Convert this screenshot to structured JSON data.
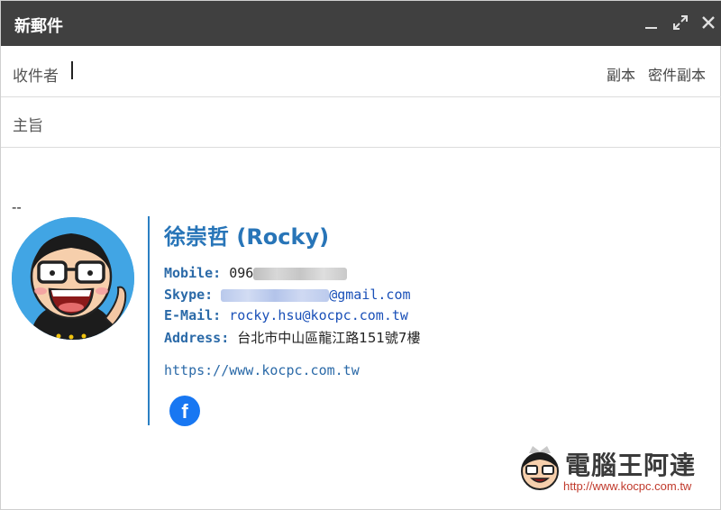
{
  "window": {
    "title": "新郵件"
  },
  "compose": {
    "to_label": "收件者",
    "cc_label": "副本",
    "bcc_label": "密件副本",
    "subject_label": "主旨"
  },
  "body": {
    "separator": "--"
  },
  "signature": {
    "name": "徐崇哲 (Rocky)",
    "mobile_label": "Mobile:",
    "mobile_value": "096",
    "skype_label": "Skype:",
    "skype_value": "@gmail.com",
    "email_label": "E-Mail:",
    "email_value": "rocky.hsu@kocpc.com.tw",
    "address_label": "Address:",
    "address_value": "台北市中山區龍江路151號7樓",
    "website": "https://www.kocpc.com.tw",
    "facebook_icon": "f"
  },
  "watermark": {
    "brand": "電腦王阿達",
    "url": "http://www.kocpc.com.tw"
  },
  "colors": {
    "titlebar": "#404040",
    "accent": "#2875b8",
    "facebook": "#1877f2"
  }
}
